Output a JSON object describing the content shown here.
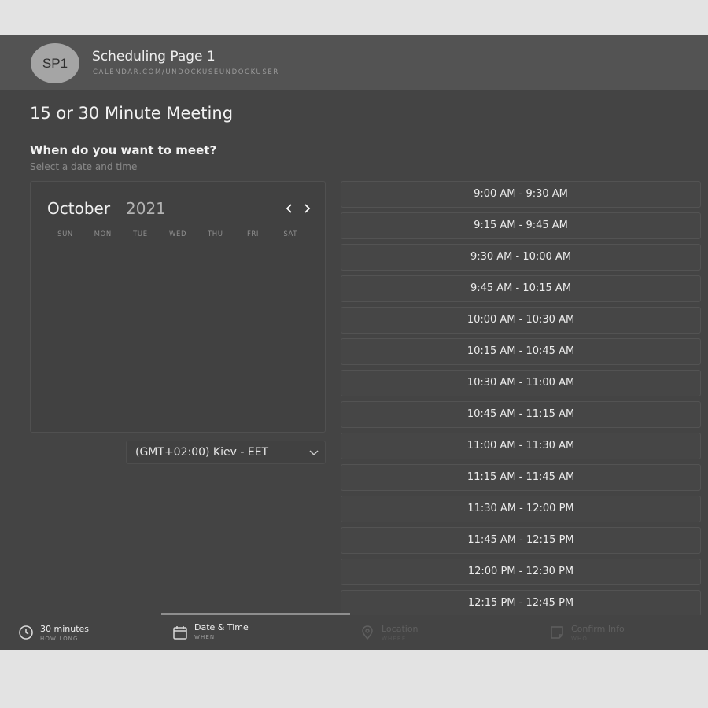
{
  "header": {
    "avatar_initials": "SP1",
    "title": "Scheduling Page 1",
    "subtitle": "CALENDAR.COM/UNDOCKUSEUNDOCKUSER"
  },
  "meeting": {
    "title": "15 or 30 Minute Meeting",
    "question": "When do you want to meet?",
    "question_sub": "Select a date and time"
  },
  "calendar": {
    "month": "October",
    "year": "2021",
    "prev_label": "‹",
    "next_label": "›",
    "weekdays": [
      "SUN",
      "MON",
      "TUE",
      "WED",
      "THU",
      "FRI",
      "SAT"
    ]
  },
  "timezone": {
    "value": "(GMT+02:00) Kiev - EET"
  },
  "slots": [
    "9:00 AM - 9:30 AM",
    "9:15 AM - 9:45 AM",
    "9:30 AM - 10:00 AM",
    "9:45 AM - 10:15 AM",
    "10:00 AM - 10:30 AM",
    "10:15 AM - 10:45 AM",
    "10:30 AM - 11:00 AM",
    "10:45 AM - 11:15 AM",
    "11:00 AM - 11:30 AM",
    "11:15 AM - 11:45 AM",
    "11:30 AM - 12:00 PM",
    "11:45 AM - 12:15 PM",
    "12:00 PM - 12:30 PM",
    "12:15 PM - 12:45 PM"
  ],
  "steps": [
    {
      "label": "30 minutes",
      "sub": "HOW LONG",
      "icon": "clock-icon",
      "state": "done"
    },
    {
      "label": "Date & Time",
      "sub": "WHEN",
      "icon": "calendar-icon",
      "state": "active"
    },
    {
      "label": "Location",
      "sub": "WHERE",
      "icon": "location-pin-icon",
      "state": "inactive"
    },
    {
      "label": "Confirm Info",
      "sub": "WHO",
      "icon": "note-icon",
      "state": "inactive"
    }
  ]
}
